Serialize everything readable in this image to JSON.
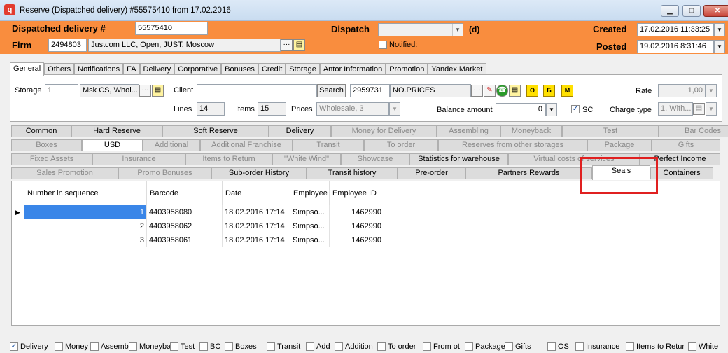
{
  "window": {
    "title": "Reserve (Dispatched delivery) #55575410 from 17.02.2016",
    "min": "▁",
    "max": "□",
    "close": "✕"
  },
  "header": {
    "dispatched_label": "Dispatched delivery #",
    "dispatched_value": "55575410",
    "dispatch_label": "Dispatch",
    "dispatch_suffix": "(d)",
    "created_label": "Created",
    "created_value": "17.02.2016 11:33:25",
    "firm_label": "Firm",
    "firm_code": "2494803",
    "firm_name": "Justcom LLC, Open, JUST, Moscow",
    "notified_label": "Notified:",
    "posted_label": "Posted",
    "posted_value": "19.02.2016 8:31:46"
  },
  "tabs_top": [
    "General",
    "Others",
    "Notifications",
    "FA",
    "Delivery",
    "Corporative",
    "Bonuses",
    "Credit",
    "Storage",
    "Antor Information",
    "Promotion",
    "Yandex.Market"
  ],
  "general": {
    "storage_label": "Storage",
    "storage_value": "1",
    "storage_name": "Msk CS, Whol...",
    "client_label": "Client",
    "search_btn": "Search",
    "client_code": "2959731",
    "client_name": "NO.PRICES",
    "btn_o1": "О",
    "btn_b": "Б",
    "btn_m": "М",
    "rate_label": "Rate",
    "rate_value": "1,00",
    "lines_label": "Lines",
    "lines_value": "14",
    "items_label": "Items",
    "items_value": "15",
    "prices_label": "Prices",
    "prices_value": "Wholesale, 3",
    "balance_label": "Balance amount",
    "balance_value": "0",
    "sc_label": "SC",
    "charge_label": "Charge type",
    "charge_value": "1, With..."
  },
  "tabgrid": [
    [
      "Common",
      "Hard Reserve",
      "Soft Reserve",
      "Delivery",
      "Money for Delivery",
      "Assembling",
      "Moneyback",
      "Test",
      "Bar Codes"
    ],
    [
      "Boxes",
      "USD",
      "Additional",
      "Additional Franchise",
      "Transit",
      "To order",
      "Reserves from other storages",
      "Package",
      "Gifts"
    ],
    [
      "Fixed Assets",
      "Insurance",
      "Items to Return",
      "\"White Wind\"",
      "Showcase",
      "Statistics for warehouse",
      "Virtual costs of services",
      "Perfect Income"
    ],
    [
      "Sales Promotion",
      "Promo Bonuses",
      "Sub-order History",
      "Transit history",
      "Pre-order",
      "Partners Rewards",
      "Seals",
      "Containers"
    ]
  ],
  "table": {
    "columns": [
      "Number in sequence",
      "Barcode",
      "Date",
      "Employee",
      "Employee ID"
    ],
    "rows": [
      [
        "1",
        "4403958080",
        "18.02.2016 17:14",
        "Simpso...",
        "1462990"
      ],
      [
        "2",
        "4403958062",
        "18.02.2016 17:14",
        "Simpso...",
        "1462990"
      ],
      [
        "3",
        "4403958061",
        "18.02.2016 17:14",
        "Simpso...",
        "1462990"
      ]
    ]
  },
  "bottom": [
    "Delivery",
    "Money",
    "Assemb",
    "Moneyba",
    "Test",
    "BC",
    "Boxes",
    "Transit",
    "Add",
    "Addition",
    "To order",
    "From ot",
    "Package",
    "Gifts",
    "OS",
    "Insurance",
    "Items to Retur",
    "White"
  ]
}
